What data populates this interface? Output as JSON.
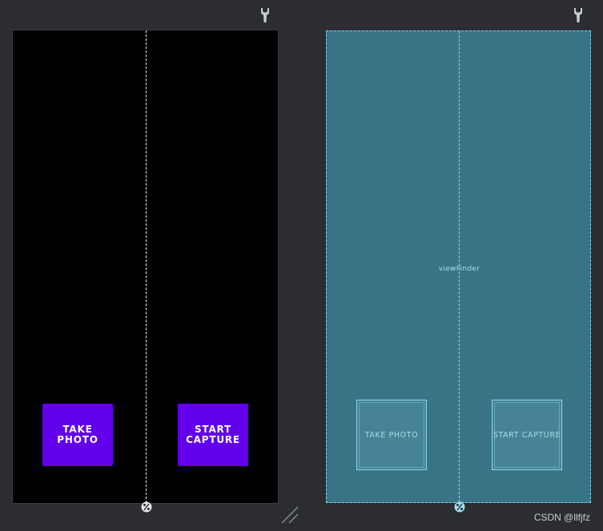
{
  "design_view": {
    "buttons": [
      {
        "label": "TAKE\nPHOTO"
      },
      {
        "label": "START\nCAPTURE"
      }
    ],
    "background_color": "#000000",
    "button_color": "#6200ee"
  },
  "blueprint_view": {
    "view_label": "viewFinder",
    "buttons": [
      {
        "label": "TAKE PHOTO"
      },
      {
        "label": "START CAPTURE"
      }
    ],
    "background_color": "#3a7587"
  },
  "icons": {
    "toolbar": "wrench-icon",
    "guideline": "percent-guideline-icon",
    "resize": "resize-handle-icon"
  },
  "watermark": "CSDN @llfjfz"
}
